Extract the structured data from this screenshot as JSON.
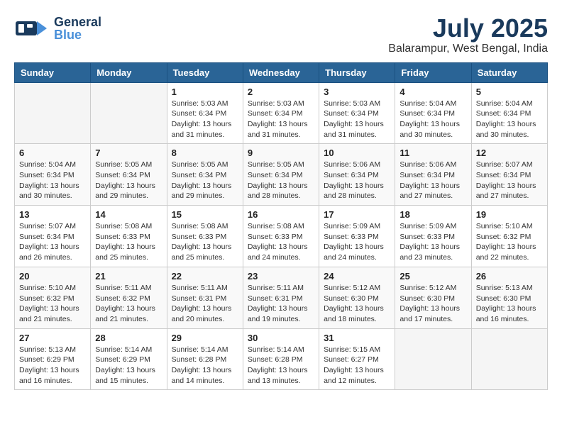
{
  "header": {
    "logo_general": "General",
    "logo_blue": "Blue",
    "month_title": "July 2025",
    "location": "Balarampur, West Bengal, India"
  },
  "calendar": {
    "days_of_week": [
      "Sunday",
      "Monday",
      "Tuesday",
      "Wednesday",
      "Thursday",
      "Friday",
      "Saturday"
    ],
    "weeks": [
      [
        {
          "day": "",
          "info": ""
        },
        {
          "day": "",
          "info": ""
        },
        {
          "day": "1",
          "info": "Sunrise: 5:03 AM\nSunset: 6:34 PM\nDaylight: 13 hours and 31 minutes."
        },
        {
          "day": "2",
          "info": "Sunrise: 5:03 AM\nSunset: 6:34 PM\nDaylight: 13 hours and 31 minutes."
        },
        {
          "day": "3",
          "info": "Sunrise: 5:03 AM\nSunset: 6:34 PM\nDaylight: 13 hours and 31 minutes."
        },
        {
          "day": "4",
          "info": "Sunrise: 5:04 AM\nSunset: 6:34 PM\nDaylight: 13 hours and 30 minutes."
        },
        {
          "day": "5",
          "info": "Sunrise: 5:04 AM\nSunset: 6:34 PM\nDaylight: 13 hours and 30 minutes."
        }
      ],
      [
        {
          "day": "6",
          "info": "Sunrise: 5:04 AM\nSunset: 6:34 PM\nDaylight: 13 hours and 30 minutes."
        },
        {
          "day": "7",
          "info": "Sunrise: 5:05 AM\nSunset: 6:34 PM\nDaylight: 13 hours and 29 minutes."
        },
        {
          "day": "8",
          "info": "Sunrise: 5:05 AM\nSunset: 6:34 PM\nDaylight: 13 hours and 29 minutes."
        },
        {
          "day": "9",
          "info": "Sunrise: 5:05 AM\nSunset: 6:34 PM\nDaylight: 13 hours and 28 minutes."
        },
        {
          "day": "10",
          "info": "Sunrise: 5:06 AM\nSunset: 6:34 PM\nDaylight: 13 hours and 28 minutes."
        },
        {
          "day": "11",
          "info": "Sunrise: 5:06 AM\nSunset: 6:34 PM\nDaylight: 13 hours and 27 minutes."
        },
        {
          "day": "12",
          "info": "Sunrise: 5:07 AM\nSunset: 6:34 PM\nDaylight: 13 hours and 27 minutes."
        }
      ],
      [
        {
          "day": "13",
          "info": "Sunrise: 5:07 AM\nSunset: 6:34 PM\nDaylight: 13 hours and 26 minutes."
        },
        {
          "day": "14",
          "info": "Sunrise: 5:08 AM\nSunset: 6:33 PM\nDaylight: 13 hours and 25 minutes."
        },
        {
          "day": "15",
          "info": "Sunrise: 5:08 AM\nSunset: 6:33 PM\nDaylight: 13 hours and 25 minutes."
        },
        {
          "day": "16",
          "info": "Sunrise: 5:08 AM\nSunset: 6:33 PM\nDaylight: 13 hours and 24 minutes."
        },
        {
          "day": "17",
          "info": "Sunrise: 5:09 AM\nSunset: 6:33 PM\nDaylight: 13 hours and 24 minutes."
        },
        {
          "day": "18",
          "info": "Sunrise: 5:09 AM\nSunset: 6:33 PM\nDaylight: 13 hours and 23 minutes."
        },
        {
          "day": "19",
          "info": "Sunrise: 5:10 AM\nSunset: 6:32 PM\nDaylight: 13 hours and 22 minutes."
        }
      ],
      [
        {
          "day": "20",
          "info": "Sunrise: 5:10 AM\nSunset: 6:32 PM\nDaylight: 13 hours and 21 minutes."
        },
        {
          "day": "21",
          "info": "Sunrise: 5:11 AM\nSunset: 6:32 PM\nDaylight: 13 hours and 21 minutes."
        },
        {
          "day": "22",
          "info": "Sunrise: 5:11 AM\nSunset: 6:31 PM\nDaylight: 13 hours and 20 minutes."
        },
        {
          "day": "23",
          "info": "Sunrise: 5:11 AM\nSunset: 6:31 PM\nDaylight: 13 hours and 19 minutes."
        },
        {
          "day": "24",
          "info": "Sunrise: 5:12 AM\nSunset: 6:30 PM\nDaylight: 13 hours and 18 minutes."
        },
        {
          "day": "25",
          "info": "Sunrise: 5:12 AM\nSunset: 6:30 PM\nDaylight: 13 hours and 17 minutes."
        },
        {
          "day": "26",
          "info": "Sunrise: 5:13 AM\nSunset: 6:30 PM\nDaylight: 13 hours and 16 minutes."
        }
      ],
      [
        {
          "day": "27",
          "info": "Sunrise: 5:13 AM\nSunset: 6:29 PM\nDaylight: 13 hours and 16 minutes."
        },
        {
          "day": "28",
          "info": "Sunrise: 5:14 AM\nSunset: 6:29 PM\nDaylight: 13 hours and 15 minutes."
        },
        {
          "day": "29",
          "info": "Sunrise: 5:14 AM\nSunset: 6:28 PM\nDaylight: 13 hours and 14 minutes."
        },
        {
          "day": "30",
          "info": "Sunrise: 5:14 AM\nSunset: 6:28 PM\nDaylight: 13 hours and 13 minutes."
        },
        {
          "day": "31",
          "info": "Sunrise: 5:15 AM\nSunset: 6:27 PM\nDaylight: 13 hours and 12 minutes."
        },
        {
          "day": "",
          "info": ""
        },
        {
          "day": "",
          "info": ""
        }
      ]
    ]
  }
}
